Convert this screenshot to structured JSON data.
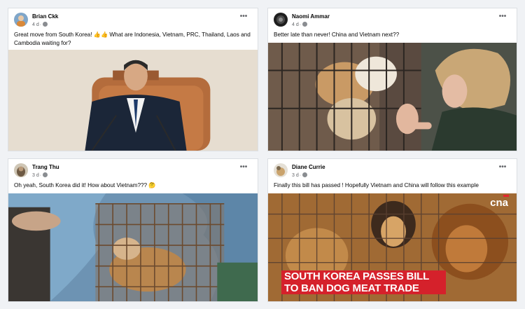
{
  "posts": [
    {
      "author": "Brian Ckk",
      "time": "4 d",
      "text": "Great move from South Korea! 👍👍 What are Indonesia, Vietnam, PRC, Thailand, Laos and Cambodia waiting for?",
      "image": "photo of a man in a suit at a podium"
    },
    {
      "author": "Naomi Ammar",
      "time": "4 d",
      "text": "Better late than never! China and Vietnam next??",
      "image": "photo of a woman reaching toward dogs in a cage"
    },
    {
      "author": "Trang Thu",
      "time": "3 d",
      "text": "Oh yeah, South Korea did it! How about Vietnam??? 🤔",
      "image": "photo of a dog in a wire cage on a blue tarp"
    },
    {
      "author": "Diane Currie",
      "time": "3 d",
      "text": "Finally this bill has passed ! Hopefully Vietnam and China will follow this example",
      "image": "news still of dogs in cages",
      "headline_line1": "SOUTH KOREA PASSES BILL",
      "headline_line2": "TO BAN DOG MEAT TRADE",
      "logo": "cna"
    }
  ],
  "ui": {
    "more_glyph": "•••",
    "dot": "·",
    "icons": [
      "globe-icon",
      "more-options-icon"
    ]
  }
}
